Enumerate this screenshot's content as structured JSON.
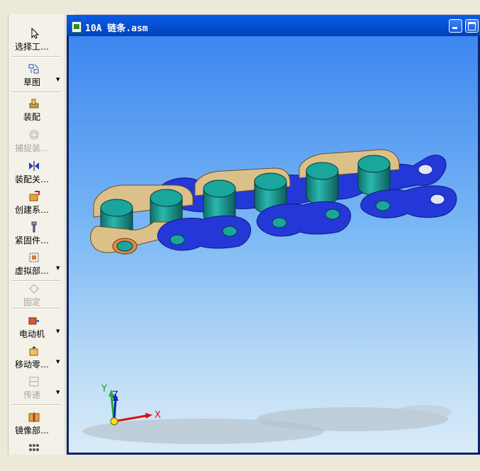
{
  "window": {
    "title": "10A 链条.asm"
  },
  "toolbar": {
    "items": [
      {
        "label": "选择工…",
        "icon": "cursor-icon",
        "disabled": false,
        "dropdown": false
      },
      {
        "label": "草图",
        "icon": "sketch-icon",
        "disabled": false,
        "dropdown": true
      },
      {
        "label": "装配",
        "icon": "assemble-icon",
        "disabled": false,
        "dropdown": false
      },
      {
        "label": "捕捉装…",
        "icon": "capture-icon",
        "disabled": true,
        "dropdown": false
      },
      {
        "label": "装配关…",
        "icon": "relation-icon",
        "disabled": false,
        "dropdown": false
      },
      {
        "label": "创建系…",
        "icon": "create-system-icon",
        "disabled": false,
        "dropdown": false
      },
      {
        "label": "紧固件…",
        "icon": "fastener-icon",
        "disabled": false,
        "dropdown": false
      },
      {
        "label": "虚拟部…",
        "icon": "virtual-part-icon",
        "disabled": false,
        "dropdown": true
      },
      {
        "label": "固定",
        "icon": "ground-icon",
        "disabled": true,
        "dropdown": false
      },
      {
        "label": "电动机",
        "icon": "motor-icon",
        "disabled": false,
        "dropdown": true
      },
      {
        "label": "移动零…",
        "icon": "move-part-icon",
        "disabled": false,
        "dropdown": true
      },
      {
        "label": "传递",
        "icon": "transfer-icon",
        "disabled": true,
        "dropdown": true
      },
      {
        "label": "镜像部…",
        "icon": "mirror-icon",
        "disabled": false,
        "dropdown": false
      }
    ]
  },
  "axes": {
    "x": "X",
    "y": "Y",
    "z": "Z"
  },
  "colors": {
    "link_outer": "#2438d8",
    "link_inner": "#dcc08a",
    "roller": "#1aa59d",
    "title_bar": "#0653d8"
  }
}
